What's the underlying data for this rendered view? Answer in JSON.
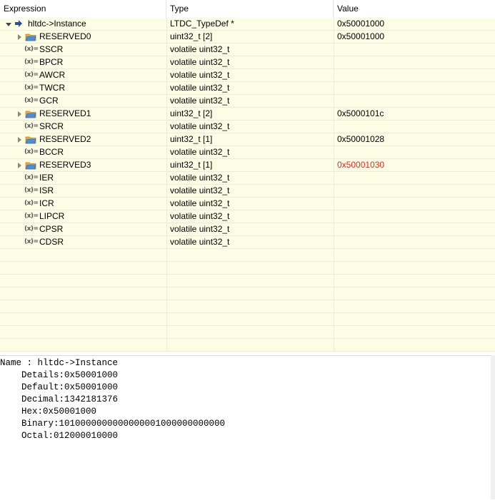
{
  "columns": {
    "expression": "Expression",
    "type": "Type",
    "value": "Value"
  },
  "rows": [
    {
      "name": "hltdc->Instance",
      "type": "LTDC_TypeDef *",
      "value": "0x50001000",
      "kind": "root",
      "twisty": "open"
    },
    {
      "name": "RESERVED0",
      "type": "uint32_t [2]",
      "value": "0x50001000",
      "kind": "array",
      "twisty": "closed"
    },
    {
      "name": "SSCR",
      "type": "volatile uint32_t",
      "value": "",
      "kind": "var"
    },
    {
      "name": "BPCR",
      "type": "volatile uint32_t",
      "value": "",
      "kind": "var"
    },
    {
      "name": "AWCR",
      "type": "volatile uint32_t",
      "value": "",
      "kind": "var"
    },
    {
      "name": "TWCR",
      "type": "volatile uint32_t",
      "value": "",
      "kind": "var"
    },
    {
      "name": "GCR",
      "type": "volatile uint32_t",
      "value": "",
      "kind": "var"
    },
    {
      "name": "RESERVED1",
      "type": "uint32_t [2]",
      "value": "0x5000101c",
      "kind": "array",
      "twisty": "closed"
    },
    {
      "name": "SRCR",
      "type": "volatile uint32_t",
      "value": "",
      "kind": "var"
    },
    {
      "name": "RESERVED2",
      "type": "uint32_t [1]",
      "value": "0x50001028",
      "kind": "array",
      "twisty": "closed"
    },
    {
      "name": "BCCR",
      "type": "volatile uint32_t",
      "value": "",
      "kind": "var"
    },
    {
      "name": "RESERVED3",
      "type": "uint32_t [1]",
      "value": "0x50001030",
      "kind": "array",
      "twisty": "closed",
      "changed": true
    },
    {
      "name": "IER",
      "type": "volatile uint32_t",
      "value": "",
      "kind": "var"
    },
    {
      "name": "ISR",
      "type": "volatile uint32_t",
      "value": "",
      "kind": "var"
    },
    {
      "name": "ICR",
      "type": "volatile uint32_t",
      "value": "",
      "kind": "var"
    },
    {
      "name": "LIPCR",
      "type": "volatile uint32_t",
      "value": "",
      "kind": "var"
    },
    {
      "name": "CPSR",
      "type": "volatile uint32_t",
      "value": "",
      "kind": "var"
    },
    {
      "name": "CDSR",
      "type": "volatile uint32_t",
      "value": "",
      "kind": "var"
    }
  ],
  "var_icon_text": "(x)=",
  "details": [
    "Name : hltdc->Instance",
    "    Details:0x50001000",
    "    Default:0x50001000",
    "    Decimal:1342181376",
    "    Hex:0x50001000",
    "    Binary:1010000000000000001000000000000",
    "    Octal:012000010000"
  ],
  "colors": {
    "changed_value": "#e0281d",
    "row_bg": "#fdfde6",
    "grid": "#ecebd9"
  }
}
